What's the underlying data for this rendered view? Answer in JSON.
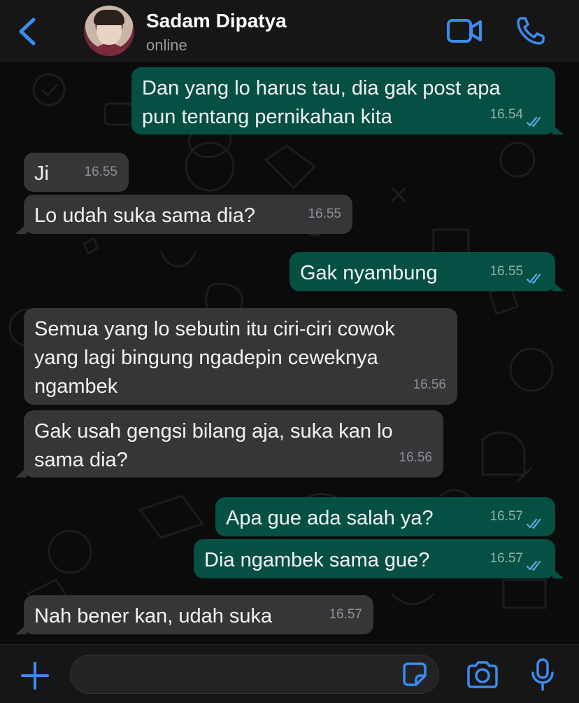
{
  "header": {
    "contact_name": "Sadam Dipatya",
    "status": "online"
  },
  "colors": {
    "accent": "#3a8cf0",
    "outgoing_bubble": "#065043",
    "incoming_bubble": "#363638",
    "read_ticks": "#5aa9e6"
  },
  "icons": {
    "back": "chevron-left-icon",
    "video": "video-camera-icon",
    "call": "phone-icon",
    "attach": "plus-icon",
    "sticker": "sticker-icon",
    "camera": "camera-icon",
    "mic": "microphone-icon"
  },
  "messages": [
    {
      "direction": "out",
      "lines": [
        "Dan yang lo harus tau, dia gak post apa",
        "pun tentang pernikahan kita"
      ],
      "time": "16.54",
      "read": true
    },
    {
      "direction": "in",
      "lines": [
        "Ji"
      ],
      "time": "16.55"
    },
    {
      "direction": "in",
      "lines": [
        "Lo udah suka sama dia?"
      ],
      "time": "16.55"
    },
    {
      "direction": "out",
      "lines": [
        "Gak nyambung"
      ],
      "time": "16.55",
      "read": true
    },
    {
      "direction": "in",
      "lines": [
        "Semua yang lo sebutin itu ciri-ciri cowok",
        "yang lagi bingung ngadepin ceweknya",
        "ngambek"
      ],
      "time": "16.56"
    },
    {
      "direction": "in",
      "lines": [
        "Gak usah gengsi bilang aja, suka kan lo",
        "sama dia?"
      ],
      "time": "16.56"
    },
    {
      "direction": "out",
      "lines": [
        "Apa gue ada salah ya?"
      ],
      "time": "16.57",
      "read": true
    },
    {
      "direction": "out",
      "lines": [
        "Dia ngambek sama gue?"
      ],
      "time": "16.57",
      "read": true
    },
    {
      "direction": "in",
      "lines": [
        "Nah bener kan, udah suka"
      ],
      "time": "16.57"
    }
  ],
  "composer": {
    "value": "",
    "placeholder": ""
  }
}
